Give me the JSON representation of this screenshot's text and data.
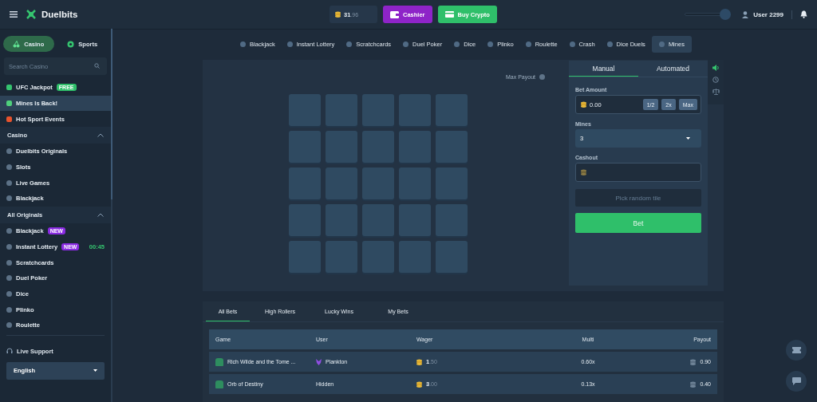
{
  "header": {
    "brand": "Duelbits",
    "balance": {
      "whole": "31",
      "fraction": ".96"
    },
    "cashier": "Cashier",
    "buy_crypto": "Buy Crypto",
    "volume": {
      "level": 1
    },
    "username": "User 2299"
  },
  "sidebar": {
    "modes": [
      {
        "label": "Casino",
        "selected": true
      },
      {
        "label": "Sports",
        "selected": false
      }
    ],
    "search": {
      "placeholder": "Search Casino"
    },
    "promos": [
      {
        "label": "UFC Jackpot",
        "badge": {
          "text": "FREE",
          "color": "#2fbf6a"
        },
        "selected": false
      },
      {
        "label": "Mines Is Back!",
        "selected": true
      },
      {
        "label": "Hot Sport Events",
        "selected": false
      }
    ],
    "sections": [
      {
        "title": "Casino",
        "expanded": true,
        "items": [
          {
            "label": "Duelbits Originals"
          },
          {
            "label": "Slots"
          },
          {
            "label": "Live Games"
          },
          {
            "label": "Blackjack"
          }
        ]
      },
      {
        "title": "All Originals",
        "expanded": true,
        "items": [
          {
            "label": "Blackjack",
            "badge": {
              "text": "NEW",
              "color": "#8a2be2"
            }
          },
          {
            "label": "Instant Lottery",
            "badge": {
              "text": "NEW",
              "color": "#8a2be2"
            },
            "timer": "00:45"
          },
          {
            "label": "Scratchcards"
          },
          {
            "label": "Duel Poker"
          },
          {
            "label": "Dice"
          },
          {
            "label": "Plinko"
          },
          {
            "label": "Roulette"
          }
        ]
      }
    ],
    "support": "Live Support",
    "language": "English"
  },
  "game_tabs": [
    {
      "label": "Blackjack",
      "selected": false
    },
    {
      "label": "Instant Lottery",
      "selected": false
    },
    {
      "label": "Scratchcards",
      "selected": false
    },
    {
      "label": "Duel Poker",
      "selected": false
    },
    {
      "label": "Dice",
      "selected": false
    },
    {
      "label": "Plinko",
      "selected": false
    },
    {
      "label": "Roulette",
      "selected": false
    },
    {
      "label": "Crash",
      "selected": false
    },
    {
      "label": "Dice Duels",
      "selected": false
    },
    {
      "label": "Mines",
      "selected": true
    }
  ],
  "game": {
    "max_payout": "Max Payout",
    "tiles": [
      {
        "revealed": false
      },
      {
        "revealed": false
      },
      {
        "revealed": false
      },
      {
        "revealed": false
      },
      {
        "revealed": false
      },
      {
        "revealed": false
      },
      {
        "revealed": false
      },
      {
        "revealed": false
      },
      {
        "revealed": false
      },
      {
        "revealed": false
      },
      {
        "revealed": false
      },
      {
        "revealed": false
      },
      {
        "revealed": false
      },
      {
        "revealed": false
      },
      {
        "revealed": false
      },
      {
        "revealed": false
      },
      {
        "revealed": false
      },
      {
        "revealed": false
      },
      {
        "revealed": false
      },
      {
        "revealed": false
      },
      {
        "revealed": false
      },
      {
        "revealed": false
      },
      {
        "revealed": false
      },
      {
        "revealed": false
      },
      {
        "revealed": false
      }
    ]
  },
  "bet_panel": {
    "tabs": [
      {
        "label": "Manual",
        "selected": true
      },
      {
        "label": "Automated",
        "selected": false
      }
    ],
    "bet_amount": {
      "label": "Bet Amount",
      "value": "0.00",
      "buttons": [
        "1/2",
        "2x",
        "Max"
      ]
    },
    "mines": {
      "label": "Mines",
      "value": "3"
    },
    "cashout": {
      "label": "Cashout"
    },
    "random_button": {
      "label": "Pick random tile",
      "disabled": true
    },
    "bet_button": "Bet",
    "sound_on": true
  },
  "bets": {
    "tabs": [
      {
        "label": "All Bets",
        "selected": true
      },
      {
        "label": "High Rollers",
        "selected": false
      },
      {
        "label": "Lucky Wins",
        "selected": false
      },
      {
        "label": "My Bets",
        "selected": false
      }
    ],
    "columns": [
      "Game",
      "User",
      "Wager",
      "Multi",
      "Payout"
    ],
    "rows": [
      {
        "game": "Rich Wilde and the Tome ...",
        "user": "Plankton",
        "rank_icon": true,
        "wager": {
          "whole": "1",
          "fraction": ".50"
        },
        "multi": "0.60x",
        "payout": "0.90"
      },
      {
        "game": "Orb of Destiny",
        "user": "Hidden",
        "rank_icon": false,
        "wager": {
          "whole": "3",
          "fraction": ".00"
        },
        "multi": "0.13x",
        "payout": "0.40"
      }
    ]
  }
}
